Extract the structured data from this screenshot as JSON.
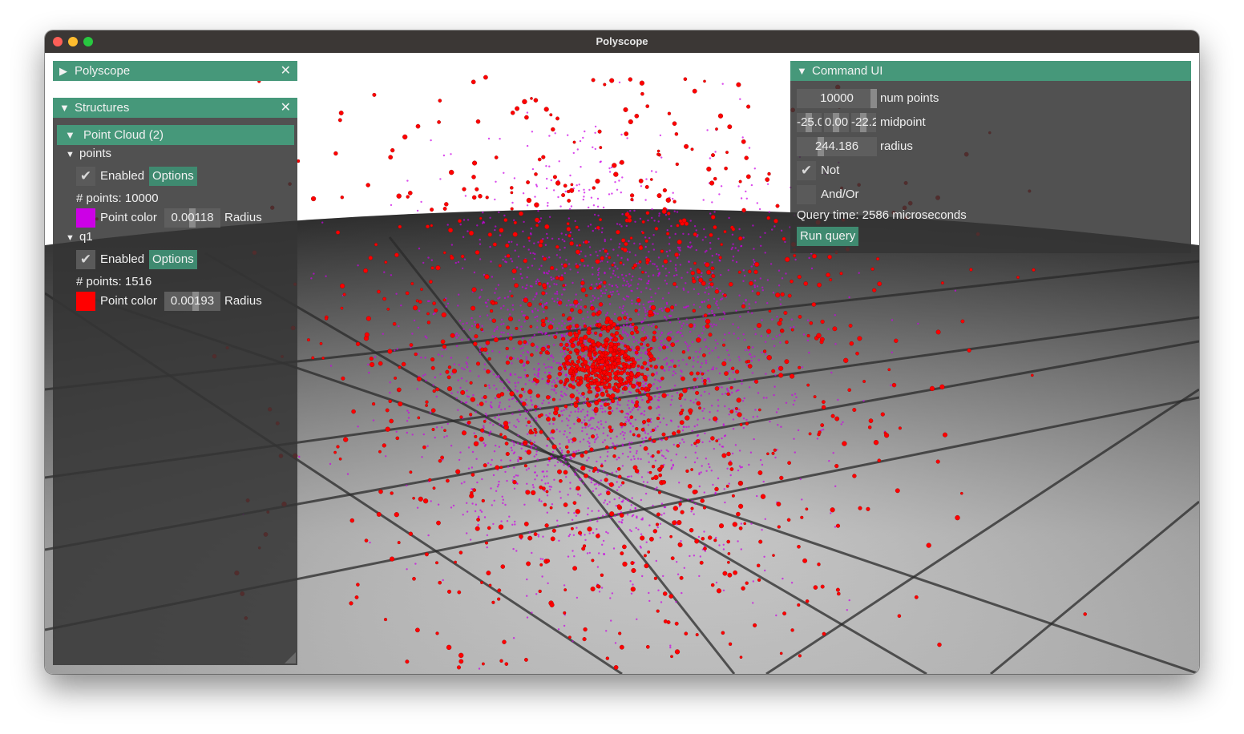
{
  "window": {
    "title": "Polyscope"
  },
  "colors": {
    "header": "#46987a",
    "button": "#3f8a70",
    "points_color": "#cc00e6",
    "q1_color": "#ff0000"
  },
  "polyscope_panel": {
    "title": "Polyscope",
    "collapsed_icon": "triangle-right-icon",
    "close_icon": "close-icon"
  },
  "structures_panel": {
    "title": "Structures",
    "group": {
      "label": "Point Cloud (2)"
    },
    "items": [
      {
        "name": "points",
        "enabled_label": "Enabled",
        "enabled": true,
        "options_label": "Options",
        "count_text": "# points: 10000",
        "color_label": "Point color",
        "radius_value": "0.00118",
        "radius_label": "Radius"
      },
      {
        "name": "q1",
        "enabled_label": "Enabled",
        "enabled": true,
        "options_label": "Options",
        "count_text": "# points: 1516",
        "color_label": "Point color",
        "radius_value": "0.00193",
        "radius_label": "Radius"
      }
    ]
  },
  "command_panel": {
    "title": "Command UI",
    "num_points": {
      "value": "10000",
      "label": "num points"
    },
    "midpoint": {
      "x": "-25.0",
      "y": "0.00",
      "z": "-22.2",
      "label": "midpoint"
    },
    "radius": {
      "value": "244.186",
      "label": "radius"
    },
    "not": {
      "label": "Not",
      "checked": true
    },
    "and_or": {
      "label": "And/Or",
      "checked": false
    },
    "query_time": "Query time: 2586 microseconds",
    "run_button": "Run query"
  }
}
